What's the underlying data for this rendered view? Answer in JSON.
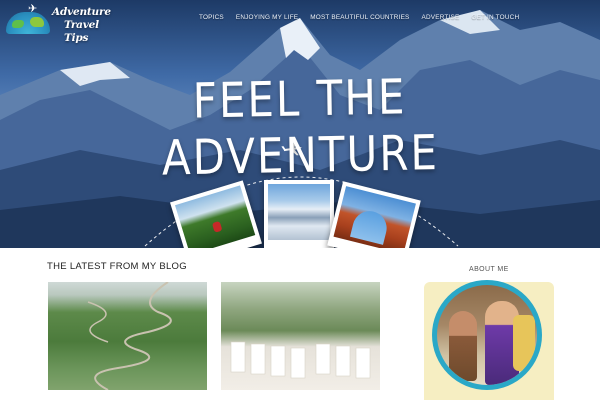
{
  "site": {
    "logo_line1": "Adventure",
    "logo_line2": "Travel Tips"
  },
  "nav": {
    "items": [
      "TOPICS",
      "ENJOYING MY LIFE",
      "MOST BEAUTIFUL COUNTRIES",
      "ADVERTISE",
      "GET IN TOUCH"
    ]
  },
  "hero": {
    "headline": "FEEL THE ADVENTURE"
  },
  "blog": {
    "heading": "THE LATEST FROM MY BLOG",
    "posts": [
      {
        "caption": ""
      },
      {
        "caption": ""
      }
    ]
  },
  "sidebar": {
    "about_label": "ABOUT ME"
  },
  "colors": {
    "about_ring": "#2aa8c7",
    "about_card": "#f6eec2"
  }
}
